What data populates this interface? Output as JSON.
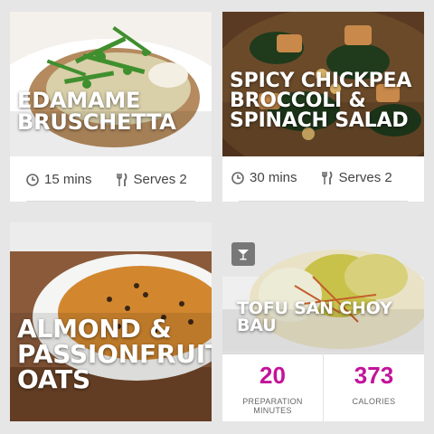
{
  "recipes": [
    {
      "title": "EDAMAME BRUSCHETTA",
      "time": "15 mins",
      "serves": "Serves 2"
    },
    {
      "title": "SPICY CHICKPEA BROCCOLI & SPINACH SALAD",
      "time": "30 mins",
      "serves": "Serves 2"
    },
    {
      "title": "ALMOND & PASSIONFRUIT OATS"
    },
    {
      "title": "TOFU SAN CHOY BAU",
      "prep_minutes": "20",
      "prep_label": "PREPARATION MINUTES",
      "calories": "373",
      "calories_label": "CALORIES"
    }
  ],
  "colors": {
    "accent": "#c3139a",
    "background": "#e6e6e6"
  },
  "icons": [
    "clock-icon",
    "fork-knife-icon",
    "cocktail-glass-icon"
  ]
}
